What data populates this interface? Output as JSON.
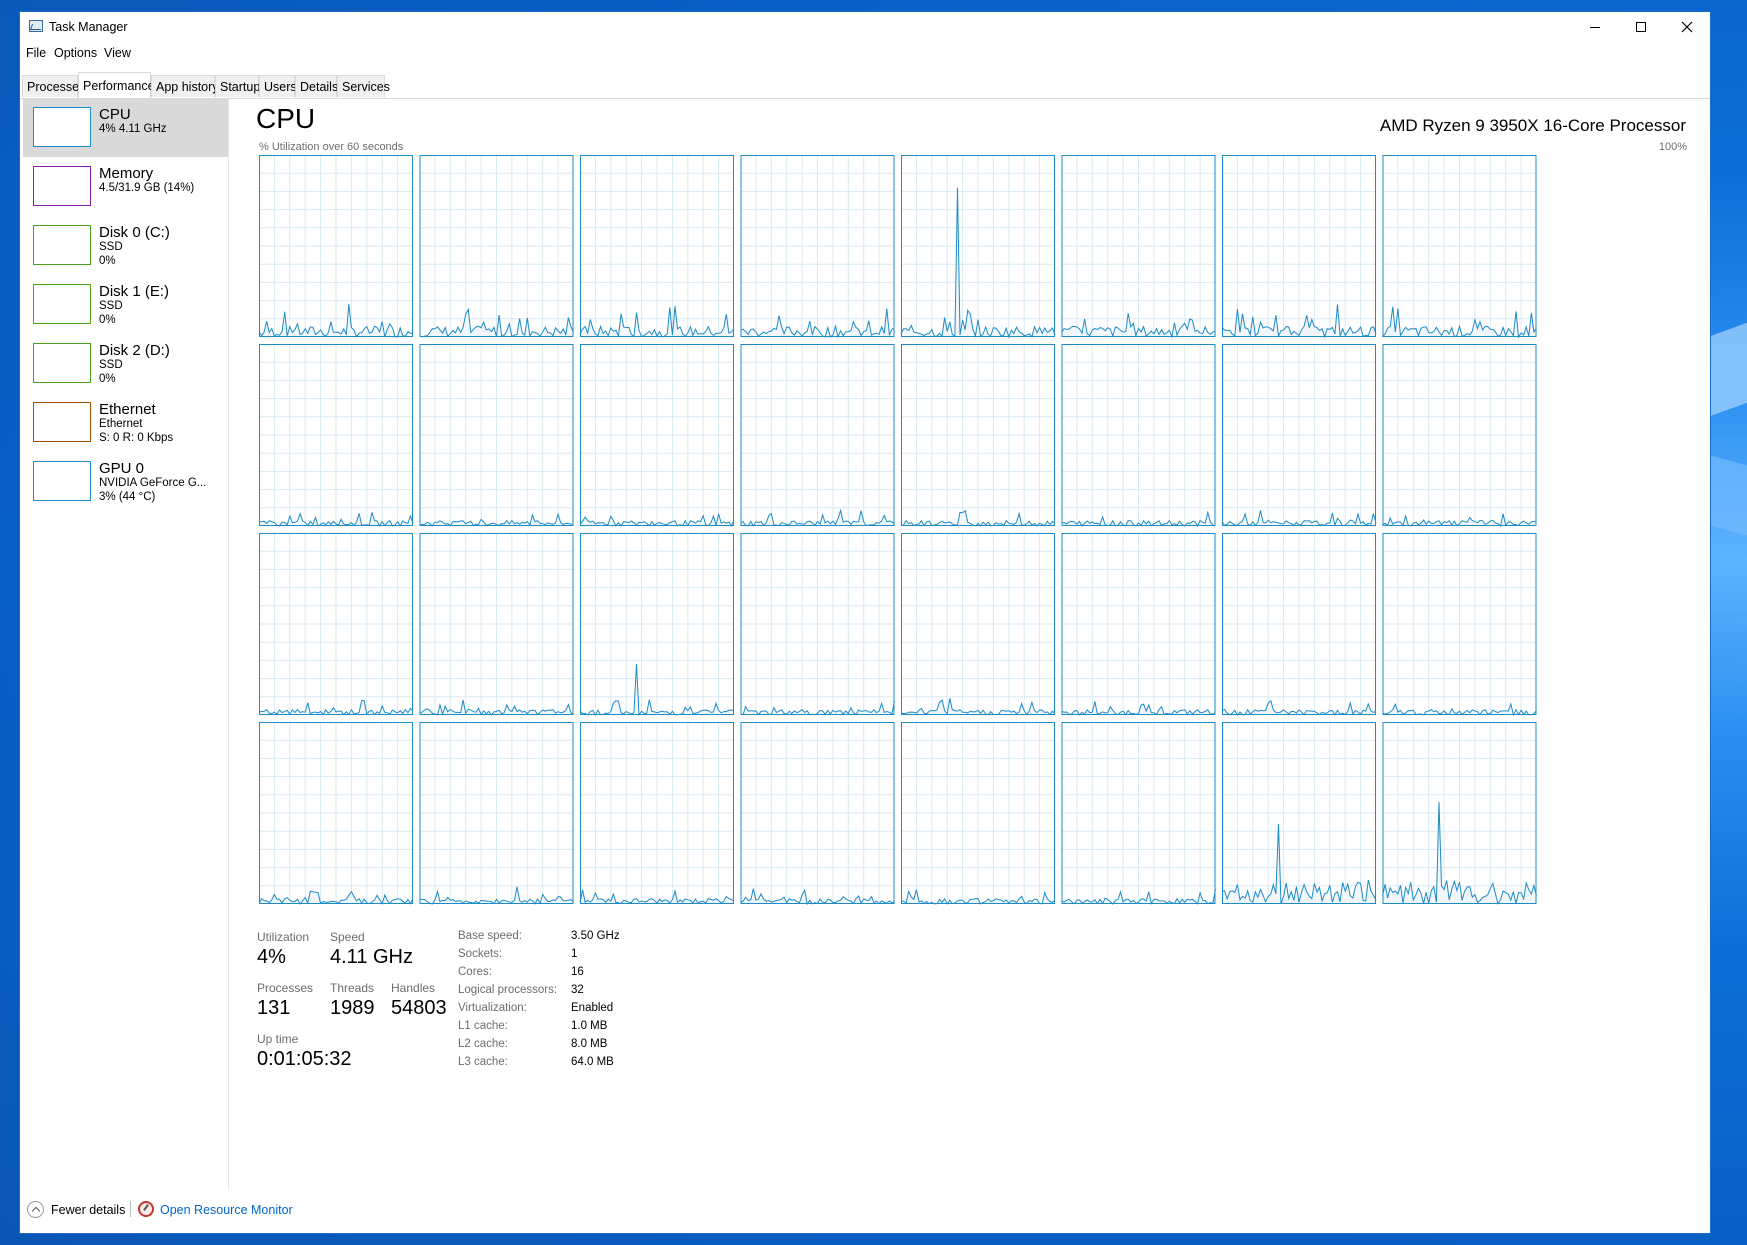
{
  "window": {
    "title": "Task Manager",
    "accent_color": "#1a6fc4"
  },
  "menu": [
    "File",
    "Options",
    "View"
  ],
  "tabs": [
    "Processes",
    "Performance",
    "App history",
    "Startup",
    "Users",
    "Details",
    "Services"
  ],
  "active_tab": "Performance",
  "sidebar": {
    "items": [
      {
        "name": "CPU",
        "lines": [
          "4% 4.11 GHz"
        ],
        "color": "#1d8bc7",
        "active": true
      },
      {
        "name": "Memory",
        "lines": [
          "4.5/31.9 GB (14%)"
        ],
        "color": "#8b1fae",
        "active": false
      },
      {
        "name": "Disk 0 (C:)",
        "lines": [
          "SSD",
          "0%"
        ],
        "color": "#4aa51d",
        "active": false
      },
      {
        "name": "Disk 1 (E:)",
        "lines": [
          "SSD",
          "0%"
        ],
        "color": "#4aa51d",
        "active": false
      },
      {
        "name": "Disk 2 (D:)",
        "lines": [
          "SSD",
          "0%"
        ],
        "color": "#4aa51d",
        "active": false
      },
      {
        "name": "Ethernet",
        "lines": [
          "Ethernet",
          "S: 0 R: 0 Kbps"
        ],
        "color": "#a74f01",
        "active": false
      },
      {
        "name": "GPU 0",
        "lines": [
          "NVIDIA GeForce G...",
          "3% (44 °C)"
        ],
        "color": "#1d8bc7",
        "active": false
      }
    ]
  },
  "main": {
    "title": "CPU",
    "model": "AMD Ryzen 9 3950X 16-Core Processor",
    "graph_label": "% Utilization over 60 seconds",
    "graph_max": "100%",
    "graph_line_color": "#1d8bc7",
    "graph_fill_color": "#f1f6fa",
    "graph_grid_color": "#d9eaf4",
    "logical_processor_count": 32
  },
  "stats": {
    "utilization": {
      "label": "Utilization",
      "value": "4%"
    },
    "speed": {
      "label": "Speed",
      "value": "4.11 GHz"
    },
    "processes": {
      "label": "Processes",
      "value": "131"
    },
    "threads": {
      "label": "Threads",
      "value": "1989"
    },
    "handles": {
      "label": "Handles",
      "value": "54803"
    },
    "uptime": {
      "label": "Up time",
      "value": "0:01:05:32"
    }
  },
  "specs": [
    {
      "label": "Base speed:",
      "value": "3.50 GHz"
    },
    {
      "label": "Sockets:",
      "value": "1"
    },
    {
      "label": "Cores:",
      "value": "16"
    },
    {
      "label": "Logical processors:",
      "value": "32"
    },
    {
      "label": "Virtualization:",
      "value": "Enabled"
    },
    {
      "label": "L1 cache:",
      "value": "1.0 MB"
    },
    {
      "label": "L2 cache:",
      "value": "8.0 MB"
    },
    {
      "label": "L3 cache:",
      "value": "64.0 MB"
    }
  ],
  "footer": {
    "fewer_details": "Fewer details",
    "open_resource_monitor": "Open Resource Monitor"
  }
}
